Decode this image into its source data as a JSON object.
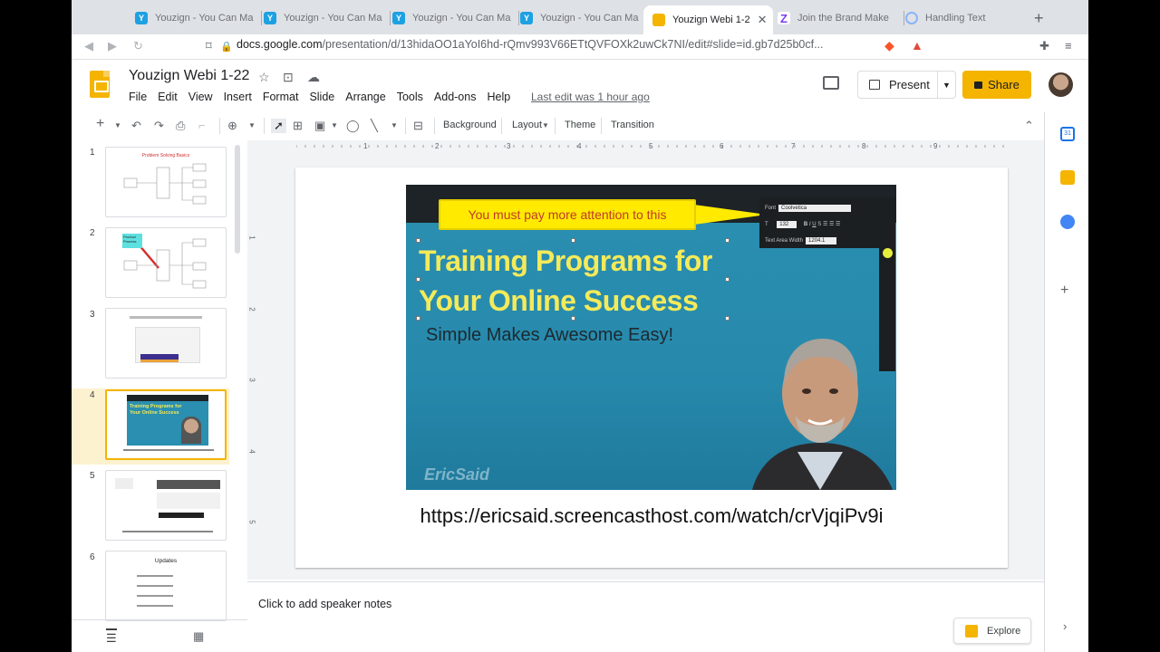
{
  "browser": {
    "tabs": [
      {
        "label": "Youzign - You Can Ma",
        "favicon": "youzign-icon",
        "active": false
      },
      {
        "label": "Youzign - You Can Ma",
        "favicon": "youzign-icon",
        "active": false
      },
      {
        "label": "Youzign - You Can Ma",
        "favicon": "youzign-icon",
        "active": false
      },
      {
        "label": "Youzign - You Can Ma",
        "favicon": "youzign-icon",
        "active": false
      },
      {
        "label": "Youzign Webi 1-2",
        "favicon": "slides-icon",
        "active": true
      },
      {
        "label": "Join the Brand Make",
        "favicon": "zapier-icon",
        "active": false
      },
      {
        "label": "Handling Text",
        "favicon": "loading-icon",
        "active": false
      }
    ],
    "url_host": "docs.google.com",
    "url_path": "/presentation/d/13hidaOO1aYoI6hd-rQmv993V66ETtQVFOXk2uwCk7NI/edit#slide=id.gb7d25b0cf..."
  },
  "app": {
    "title": "Youzign Webi 1-22",
    "menus": [
      "File",
      "Edit",
      "View",
      "Insert",
      "Format",
      "Slide",
      "Arrange",
      "Tools",
      "Add-ons",
      "Help"
    ],
    "last_edit": "Last edit was 1 hour ago",
    "present_label": "Present",
    "share_label": "Share",
    "accent_color": "#f4b400"
  },
  "toolbar": {
    "background_label": "Background",
    "layout_label": "Layout",
    "theme_label": "Theme",
    "transition_label": "Transition"
  },
  "ruler": {
    "top_ticks": [
      "1",
      "2",
      "3",
      "4",
      "5",
      "6",
      "7",
      "8",
      "9"
    ],
    "left_ticks": [
      "1",
      "2",
      "3",
      "4",
      "5"
    ]
  },
  "filmstrip": {
    "selected": "4",
    "slides": [
      {
        "num": "1",
        "caption": "Problem Solving Basics"
      },
      {
        "num": "2",
        "caption": "Product Process"
      },
      {
        "num": "3",
        "caption": ""
      },
      {
        "num": "4",
        "caption": "Training Programs for Your Online Success"
      },
      {
        "num": "5",
        "caption": ""
      },
      {
        "num": "6",
        "caption": "Updates"
      }
    ]
  },
  "slide": {
    "callout": "You must pay more attention to this",
    "headline_line1": "Training Programs for",
    "headline_line2": "Your Online Success",
    "subheadline": "Simple Makes Awesome Easy!",
    "brand": "EricSaid",
    "panel_font_label": "Font",
    "panel_font_value": "Coolvetica",
    "panel_size_value": "132",
    "panel_width_label": "Text Area Width",
    "panel_width_value": "1204.1",
    "url": "https://ericsaid.screencasthost.com/watch/crVjqiPv9i"
  },
  "notes": {
    "placeholder": "Click to add speaker notes"
  },
  "explore_label": "Explore"
}
